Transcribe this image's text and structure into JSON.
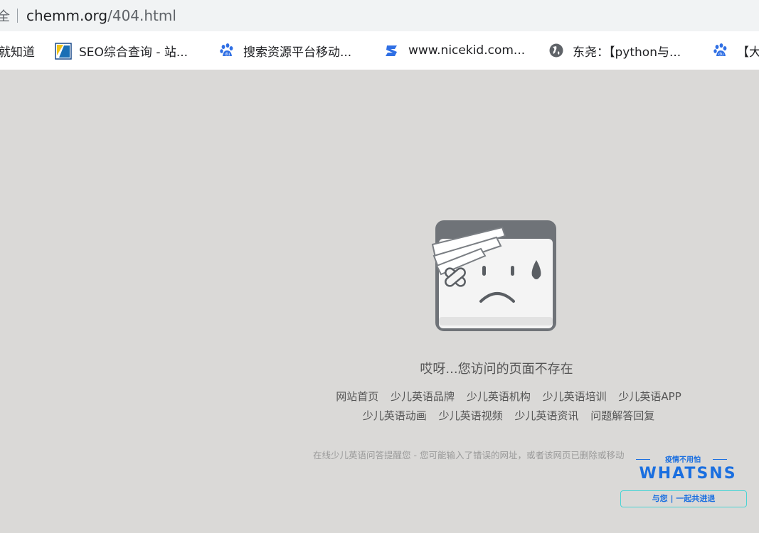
{
  "address_bar": {
    "security_partial": "全",
    "url_host": "chemm.org",
    "url_path": "/404.html"
  },
  "bookmarks": [
    {
      "label": "就知道",
      "icon": "none"
    },
    {
      "label": "SEO综合查询 - 站...",
      "icon": "seo-tool-icon"
    },
    {
      "label": "搜索资源平台移动...",
      "icon": "baidu-paw-icon"
    },
    {
      "label": "www.nicekid.com...",
      "icon": "nicekid-logo-icon"
    },
    {
      "label": "东尧：【python与...",
      "icon": "globe-icon"
    },
    {
      "label": "【大",
      "icon": "baidu-paw-icon"
    }
  ],
  "page": {
    "error_message": "哎呀...您访问的页面不存在",
    "links_row_1": [
      "网站首页",
      "少儿英语品牌",
      "少儿英语机构",
      "少儿英语培训",
      "少儿英语APP"
    ],
    "links_row_2": [
      "少儿英语动画",
      "少儿英语视频",
      "少儿英语资讯",
      "问题解答回复"
    ],
    "footer_note": "在线少儿英语问答提醒您 - 您可能输入了错误的网址，或者该网页已删除或移动"
  },
  "logo": {
    "tagline_top": "疫情不用怕",
    "brand": "WHATSNS",
    "tagline_bottom": "与您 | 一起共进退"
  },
  "colors": {
    "page_background": "#dad9d7",
    "logo_blue": "#1a6fe0",
    "logo_cyan": "#4ad4d4"
  }
}
